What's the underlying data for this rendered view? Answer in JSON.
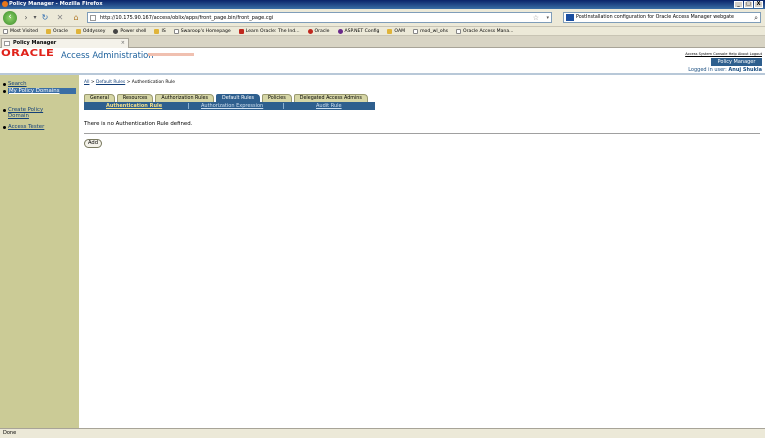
{
  "window": {
    "title": "Policy Manager - Mozilla Firefox",
    "controls": [
      "_",
      "□",
      "X"
    ]
  },
  "nav": {
    "url": "http://10.175.90.167/access/oblix/apps/front_page.bin/front_page.cgi",
    "search_text": "PostInstallation configuration for Oracle Access Manager webgate"
  },
  "bookmarks": [
    "Most Visited",
    "Oracle",
    "Oddyssey",
    "Power shell",
    "IS",
    "Swaroop's Homepage",
    "Learn Oracle: The Ind...",
    "Oracle",
    "ASP.NET Config",
    "OAM",
    "mod_wl_ohs",
    "Oracle Access Mana..."
  ],
  "browser_tab": {
    "label": "Policy Manager",
    "close": "×"
  },
  "header": {
    "logo": "ORACLE",
    "app_name": "Access Administration",
    "top_links": "Access System Console Help About Logout",
    "policy_manager": "Policy Manager",
    "logged_in_label": "Logged in user:",
    "user": "Anuj Shukla"
  },
  "sidebar": {
    "items": [
      {
        "label": "Search"
      },
      {
        "label": "My Policy Domains"
      },
      {
        "label": "Create Policy Domain"
      },
      {
        "label": "Access Tester"
      }
    ]
  },
  "breadcrumb": {
    "root": "All",
    "link": "Default Rules",
    "current": "Authentication Rule"
  },
  "tabs": [
    "General",
    "Resources",
    "Authorization Rules",
    "Default Rules",
    "Policies",
    "Delegated Access Admins"
  ],
  "subtabs": [
    "Authentication Rule",
    "Authorization Expression",
    "Audit Rule"
  ],
  "message": "There is no Authentication Rule defined.",
  "add_button": "Add",
  "status": "Done"
}
